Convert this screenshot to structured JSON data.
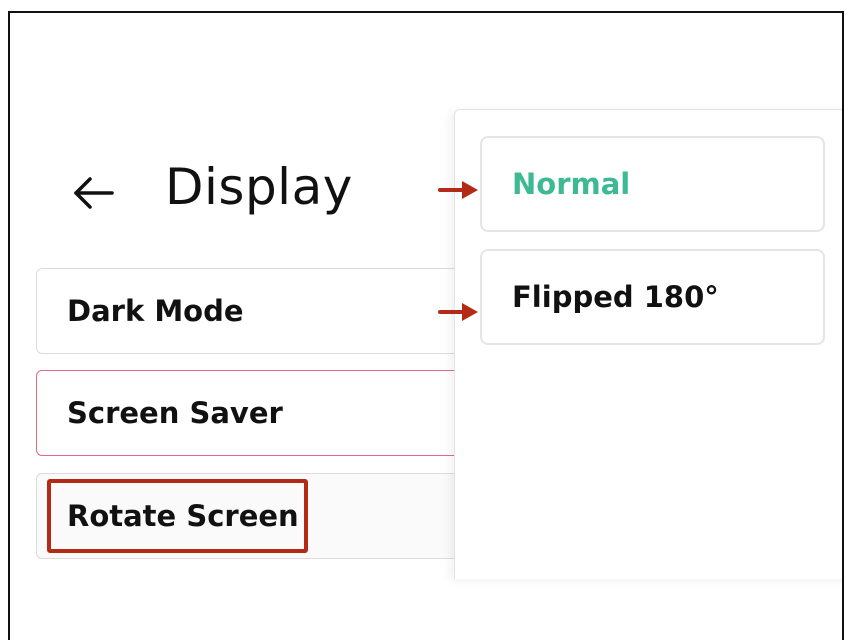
{
  "header": {
    "back_icon": "arrow-left-icon",
    "title": "Display"
  },
  "settings": {
    "items": [
      {
        "label": "Dark Mode"
      },
      {
        "label": "Screen Saver"
      },
      {
        "label": "Rotate Screen"
      }
    ]
  },
  "rotate_menu": {
    "options": [
      {
        "label": "Normal",
        "selected": true
      },
      {
        "label": "Flipped 180°",
        "selected": false
      }
    ]
  },
  "annotations": {
    "highlight_color": "#b32a17",
    "arrow_icon": "arrow-right-icon",
    "selected_color": "#3dba93",
    "focus_border_color": "#e06a88"
  }
}
